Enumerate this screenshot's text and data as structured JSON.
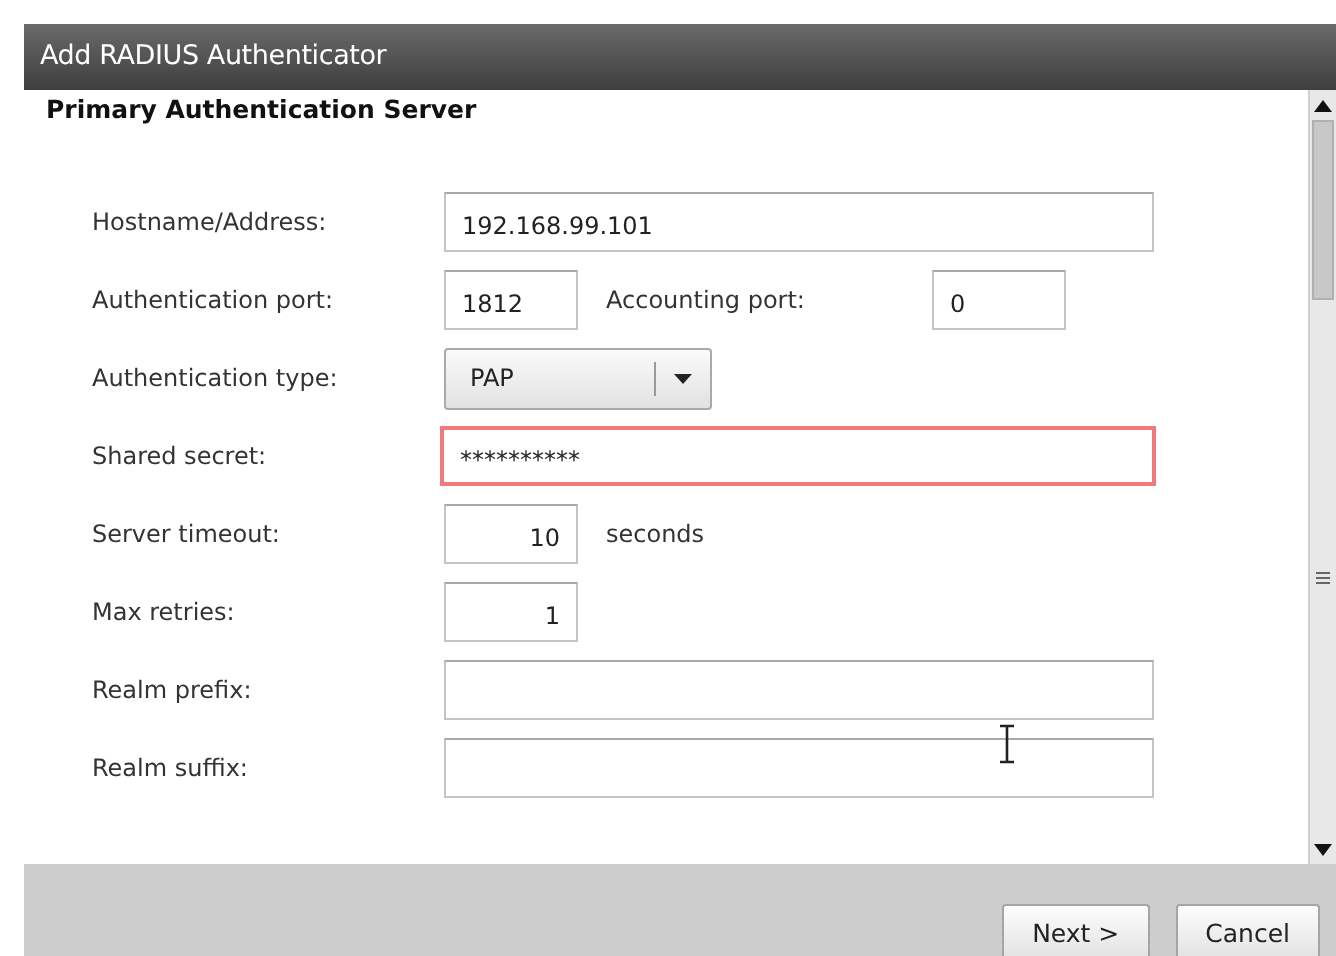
{
  "window": {
    "title": "Add RADIUS Authenticator"
  },
  "section_title": "Primary Authentication Server",
  "fields": [
    {
      "kind": "text",
      "label": "Hostname/Address:",
      "value": "192.168.99.101",
      "invalid": false
    },
    {
      "kind": "pair",
      "label": "Authentication port:",
      "value": "1812",
      "second_label": "Accounting port:",
      "second_value": "0"
    },
    {
      "kind": "select",
      "label": "Authentication type:",
      "value": "PAP"
    },
    {
      "kind": "text",
      "label": "Shared secret:",
      "value": "**********",
      "invalid": true
    },
    {
      "kind": "number",
      "label": "Server timeout:",
      "value": "10",
      "unit": "seconds"
    },
    {
      "kind": "number",
      "label": "Max retries:",
      "value": "1"
    },
    {
      "kind": "text",
      "label": "Realm prefix:",
      "invalid": false
    },
    {
      "kind": "text",
      "label": "Realm suffix:",
      "invalid": false
    }
  ],
  "buttons": [
    {
      "label": "Next >"
    },
    {
      "label": "Cancel"
    }
  ]
}
